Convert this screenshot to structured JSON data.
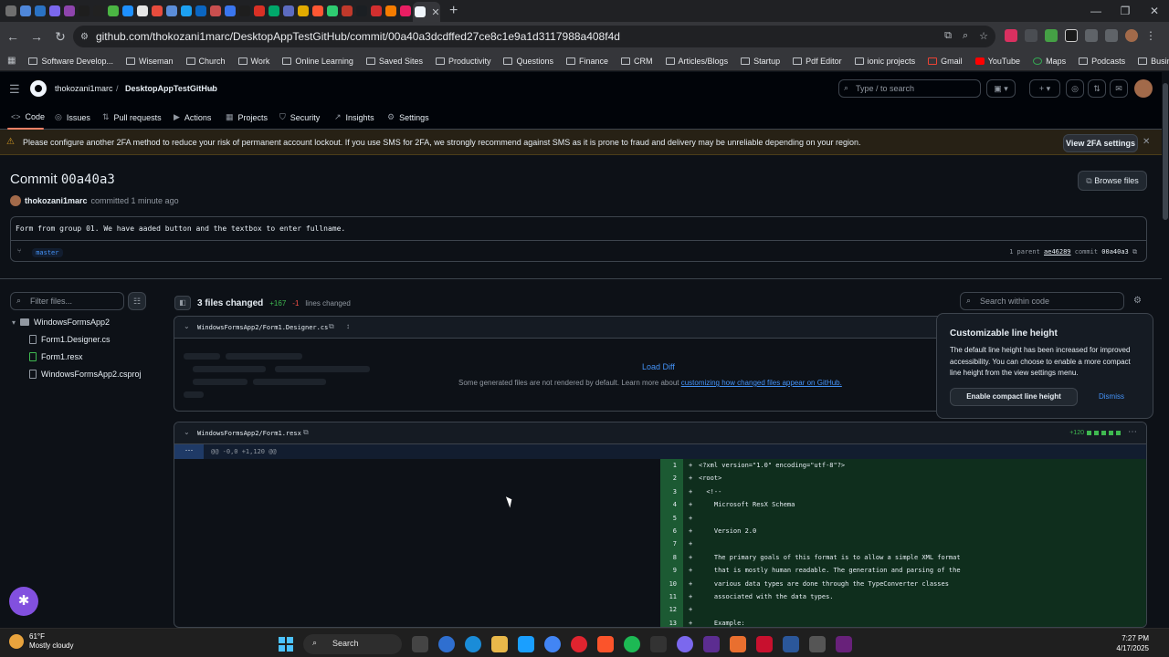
{
  "browser": {
    "url": "github.com/thokozani1marc/DesktopAppTestGitHub/commit/00a40a3dcdffed27ce8c1e9a1d3117988a408f4d",
    "tab_favicon_colors": [
      "#6f6f6f",
      "#4f87d9",
      "#2a72c4",
      "#7b68ee",
      "#8e44ad",
      "#1e1e1e",
      "#212121",
      "#4bb543",
      "#1e90ff",
      "#e5e5e5",
      "#e84c3d",
      "#5b8dd9",
      "#1da1f2",
      "#0a66c2",
      "#c94f4f",
      "#3a76f0",
      "#1e1e1e",
      "#d93025",
      "#00a86b",
      "#5c6bc0",
      "#e2ab00",
      "#ff5733",
      "#2ecc71",
      "#c0392b",
      "#1b1f23",
      "#d32f2f",
      "#f57c00",
      "#e91e63"
    ],
    "window_controls": [
      "—",
      "❐",
      "✕"
    ]
  },
  "bookmarks": [
    {
      "label": "Software Develop...",
      "icon": "folder-icon"
    },
    {
      "label": "Wiseman",
      "icon": "folder-icon"
    },
    {
      "label": "Church",
      "icon": "folder-icon"
    },
    {
      "label": "Work",
      "icon": "folder-icon"
    },
    {
      "label": "Online Learning",
      "icon": "folder-icon"
    },
    {
      "label": "Saved Sites",
      "icon": "folder-icon"
    },
    {
      "label": "Productivity",
      "icon": "folder-icon"
    },
    {
      "label": "Questions",
      "icon": "folder-icon"
    },
    {
      "label": "Finance",
      "icon": "folder-icon"
    },
    {
      "label": "CRM",
      "icon": "folder-icon"
    },
    {
      "label": "Articles/Blogs",
      "icon": "folder-icon"
    },
    {
      "label": "Startup",
      "icon": "folder-icon"
    },
    {
      "label": "Pdf Editor",
      "icon": "folder-icon"
    },
    {
      "label": "ionic projects",
      "icon": "folder-icon"
    },
    {
      "label": "Gmail",
      "icon": "gmail-icon"
    },
    {
      "label": "YouTube",
      "icon": "youtube-icon"
    },
    {
      "label": "Maps",
      "icon": "maps-icon"
    },
    {
      "label": "Podcasts",
      "icon": "folder-icon"
    },
    {
      "label": "Business",
      "icon": "folder-icon"
    }
  ],
  "github": {
    "owner": "thokozani1marc",
    "separator": "/",
    "repo": "DesktopAppTestGitHub",
    "search_placeholder": "Type / to search",
    "repo_nav": [
      "Code",
      "Issues",
      "Pull requests",
      "Actions",
      "Projects",
      "Security",
      "Insights",
      "Settings"
    ],
    "banner_text": "Please configure another 2FA method to reduce your risk of permanent account lockout. If you use SMS for 2FA, we strongly recommend against SMS as it is prone to fraud and delivery may be unreliable depending on your region.",
    "banner_button": "View 2FA settings"
  },
  "commit": {
    "title_prefix": "Commit",
    "short_sha": "00a40a3",
    "browse_files": "Browse files",
    "author": "thokozani1marc",
    "meta": "committed 1 minute ago",
    "message": "Form from group 01. We have aaded button and the textbox to enter fullname.",
    "branch": "master",
    "parents_label": "1 parent",
    "parent_sha": "ae46289",
    "commit_label": "commit",
    "commit_sha": "00a40a3"
  },
  "sidebar": {
    "filter_placeholder": "Filter files...",
    "folder": "WindowsFormsApp2",
    "files": [
      "Form1.Designer.cs",
      "Form1.resx",
      "WindowsFormsApp2.csproj"
    ]
  },
  "diff": {
    "files_changed": "3 files changed",
    "additions": "+167",
    "deletions": "-1",
    "lines_changed": "lines changed",
    "search_placeholder": "Search within code",
    "file1": {
      "name": "WindowsFormsApp2/Form1.Designer.cs",
      "load_diff": "Load Diff",
      "note": "Some generated files are not rendered by default. Learn more about",
      "note_link": "customizing how changed files appear on GitHub."
    },
    "file2": {
      "name": "WindowsFormsApp2/Form1.resx",
      "hunk": "@@ -0,0 +1,120 @@",
      "diffstat": "+120",
      "lines": [
        {
          "n": "1",
          "t": "<?xml version=\"1.0\" encoding=\"utf-8\"?>"
        },
        {
          "n": "2",
          "t": "<root>"
        },
        {
          "n": "3",
          "t": "  <!--"
        },
        {
          "n": "4",
          "t": "    Microsoft ResX Schema"
        },
        {
          "n": "5",
          "t": ""
        },
        {
          "n": "6",
          "t": "    Version 2.0"
        },
        {
          "n": "7",
          "t": ""
        },
        {
          "n": "8",
          "t": "    The primary goals of this format is to allow a simple XML format"
        },
        {
          "n": "9",
          "t": "    that is mostly human readable. The generation and parsing of the"
        },
        {
          "n": "10",
          "t": "    various data types are done through the TypeConverter classes"
        },
        {
          "n": "11",
          "t": "    associated with the data types."
        },
        {
          "n": "12",
          "t": ""
        },
        {
          "n": "13",
          "t": "    Example:"
        }
      ]
    }
  },
  "popover": {
    "title": "Customizable line height",
    "body": "The default line height has been increased for improved accessibility. You can choose to enable a more compact line height from the view settings menu.",
    "button": "Enable compact line height",
    "dismiss": "Dismiss"
  },
  "taskbar": {
    "temp": "61°F",
    "weather": "Mostly cloudy",
    "search": "Search",
    "time": "7:27 PM",
    "date": "4/17/2025"
  }
}
